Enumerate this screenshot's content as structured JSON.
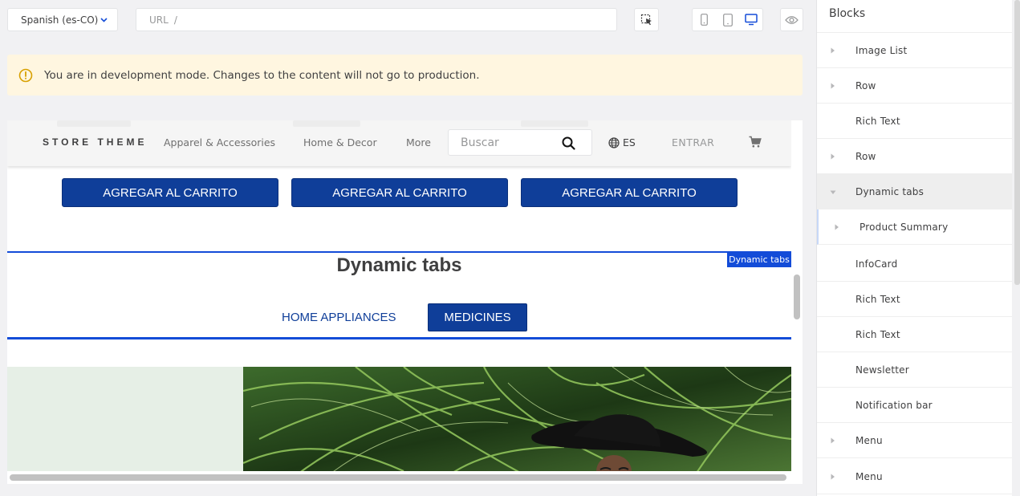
{
  "toolbar": {
    "locale": "Spanish (es-CO)",
    "url_label": "URL",
    "url_path": "/"
  },
  "banner": {
    "message": "You are in development mode. Changes to the content will not go to production."
  },
  "store": {
    "brand": "STORE THEME",
    "nav": [
      "Apparel & Accessories",
      "Home & Decor",
      "More"
    ],
    "search_placeholder": "Buscar",
    "language": "ES",
    "login": "ENTRAR",
    "add_to_cart": [
      "AGREGAR AL CARRITO",
      "AGREGAR AL CARRITO",
      "AGREGAR AL CARRITO"
    ]
  },
  "dynamic_tabs": {
    "tag": "Dynamic tabs",
    "title": "Dynamic tabs",
    "tabs": [
      "HOME APPLIANCES",
      "MEDICINES"
    ],
    "active_tab": "MEDICINES"
  },
  "panel": {
    "title": "Blocks",
    "items": [
      {
        "label": "Image List",
        "expandable": true
      },
      {
        "label": "Row",
        "expandable": true
      },
      {
        "label": "Rich Text",
        "expandable": false
      },
      {
        "label": "Row",
        "expandable": true
      },
      {
        "label": "Dynamic tabs",
        "expandable": true,
        "expanded": true,
        "selected": true
      },
      {
        "label": "Product Summary",
        "expandable": true,
        "child": true
      },
      {
        "label": "InfoCard",
        "expandable": false
      },
      {
        "label": "Rich Text",
        "expandable": false
      },
      {
        "label": "Rich Text",
        "expandable": false
      },
      {
        "label": "Newsletter",
        "expandable": false
      },
      {
        "label": "Notification bar",
        "expandable": false
      },
      {
        "label": "Menu",
        "expandable": true
      },
      {
        "label": "Menu",
        "expandable": true
      }
    ]
  },
  "colors": {
    "accent": "#134cd8",
    "brand_button": "#0f3e99",
    "banner_bg": "#fff6e0",
    "warning_icon": "#d8a000"
  },
  "icons": {
    "locale_chevron": "chevron-down-icon",
    "inspect": "cursor-select-icon",
    "mobile": "mobile-icon",
    "tablet": "tablet-icon",
    "desktop": "desktop-icon",
    "preview": "eye-icon",
    "warning": "warning-icon",
    "search": "search-icon",
    "language": "globe-icon",
    "cart": "cart-icon",
    "expand": "caret-right-icon",
    "collapse": "caret-down-icon"
  }
}
